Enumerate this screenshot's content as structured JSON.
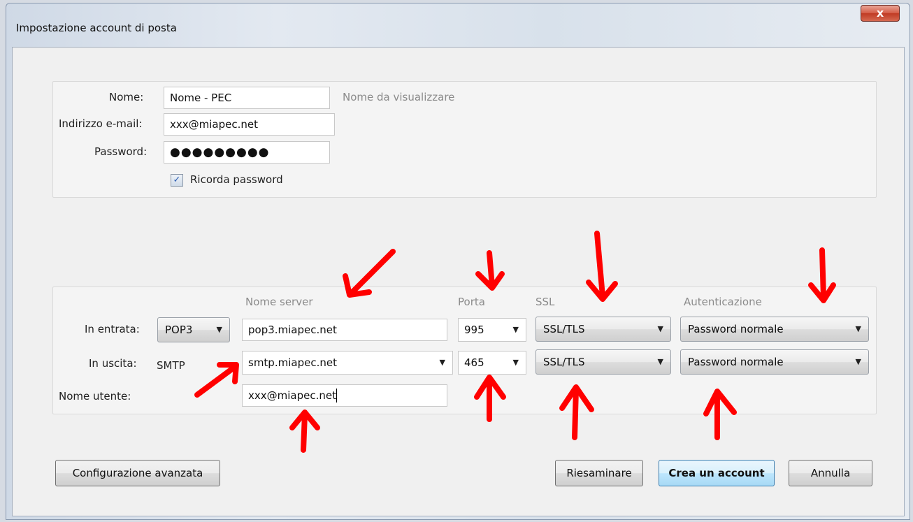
{
  "window": {
    "title": "Impostazione account di posta",
    "close_glyph": "x"
  },
  "identity": {
    "name_label": "Nome:",
    "name_value": "Nome - PEC",
    "name_hint": "Nome da visualizzare",
    "email_label": "Indirizzo e-mail:",
    "email_value": "xxx@miapec.net",
    "password_label": "Password:",
    "password_mask": "●●●●●●●●●",
    "remember_label": "Ricorda password",
    "remember_checked": true
  },
  "servers": {
    "col_server": "Nome server",
    "col_port": "Porta",
    "col_ssl": "SSL",
    "col_auth": "Autenticazione",
    "incoming": {
      "label": "In entrata:",
      "protocol": "POP3",
      "server": "pop3.miapec.net",
      "port": "995",
      "ssl": "SSL/TLS",
      "auth": "Password normale"
    },
    "outgoing": {
      "label": "In uscita:",
      "protocol": "SMTP",
      "server": "smtp.miapec.net",
      "port": "465",
      "ssl": "SSL/TLS",
      "auth": "Password normale"
    },
    "username_label": "Nome utente:",
    "username_value": "xxx@miapec.net"
  },
  "buttons": {
    "advanced": "Configurazione avanzata",
    "retest": "Riesaminare",
    "create": "Crea un account",
    "cancel": "Annulla"
  },
  "colors": {
    "annotation": "#ff0000",
    "primary_button": "#bee6fd",
    "close_button": "#c03b24"
  },
  "icons": {
    "dropdown": "chevron-down-icon",
    "close": "close-icon",
    "check": "check-icon"
  }
}
